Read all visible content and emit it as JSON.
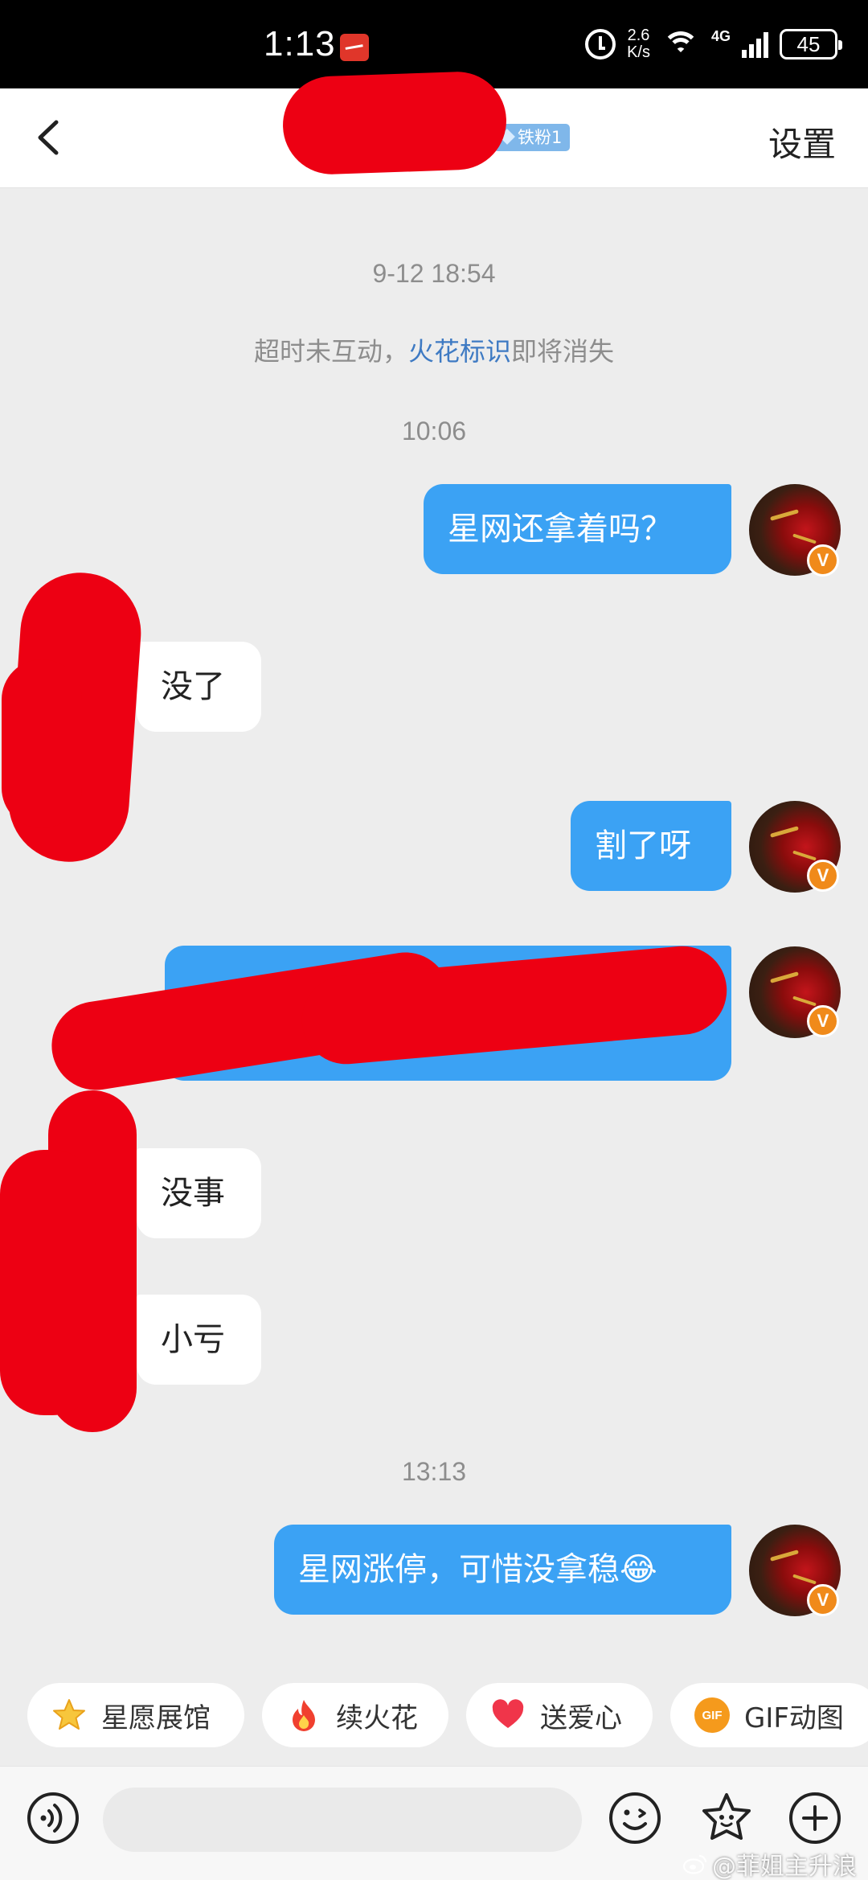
{
  "status_bar": {
    "time": "1:13",
    "net_speed_value": "2.6",
    "net_speed_unit": "K/s",
    "network_type": "4G",
    "battery": "45"
  },
  "header": {
    "fan_badge": "铁粉1",
    "settings_label": "设置"
  },
  "chat": {
    "timestamp_1": "9-12 18:54",
    "system_notice_prefix": "超时未互动，",
    "system_notice_link": "火花标识",
    "system_notice_suffix": "即将消失",
    "timestamp_2": "10:06",
    "msg_1": "星网还拿着吗？",
    "msg_2": "没了",
    "msg_3": "割了呀",
    "msg_5": "没事",
    "msg_6": "小亏",
    "timestamp_3": "13:13",
    "msg_7": "星网涨停，可惜没拿稳😂",
    "verified_mark": "V"
  },
  "quick_actions": [
    {
      "label": "星愿展馆",
      "icon": "star-icon"
    },
    {
      "label": "续火花",
      "icon": "fire-icon"
    },
    {
      "label": "送爱心",
      "icon": "heart-icon"
    },
    {
      "label": "GIF动图",
      "icon": "gif-icon",
      "icon_text": "GIF"
    }
  ],
  "input_bar": {
    "placeholder": ""
  },
  "watermark": "@菲姐主升浪",
  "colors": {
    "outgoing_bubble": "#3ba2f4",
    "incoming_bubble": "#ffffff",
    "background": "#ededed",
    "link": "#3e7ac3",
    "redaction": "#ed0013"
  }
}
